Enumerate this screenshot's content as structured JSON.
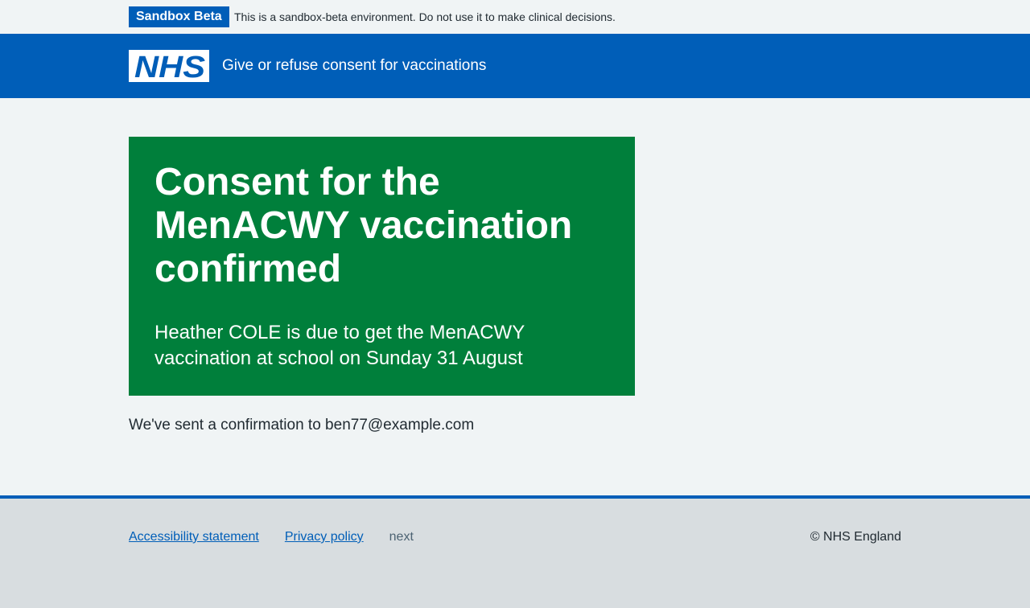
{
  "banner": {
    "badge": "Sandbox Beta",
    "message": "This is a sandbox-beta environment. Do not use it to make clinical decisions."
  },
  "header": {
    "logo_text": "NHS",
    "service_name": "Give or refuse consent for vaccinations"
  },
  "panel": {
    "title": "Consent for the MenACWY vaccination confirmed",
    "body": "Heather COLE is due to get the MenACWY vaccination at school on Sunday 31 August"
  },
  "confirmation": "We've sent a confirmation to ben77@example.com",
  "footer": {
    "links": [
      "Accessibility statement",
      "Privacy policy"
    ],
    "version": "next",
    "copyright": "© NHS England"
  },
  "colors": {
    "nhs_blue": "#005eb8",
    "panel_green": "#007f3b",
    "page_bg": "#f0f4f5",
    "footer_bg": "#d8dde0"
  }
}
